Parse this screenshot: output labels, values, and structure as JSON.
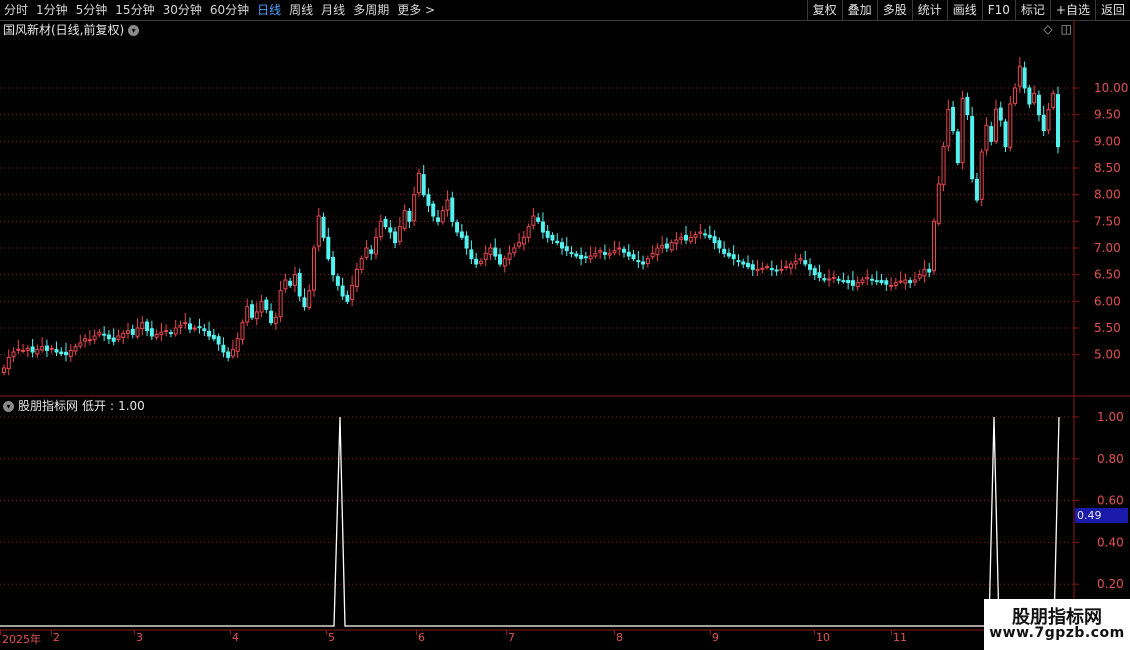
{
  "toolbar": {
    "periods": [
      "分时",
      "1分钟",
      "5分钟",
      "15分钟",
      "30分钟",
      "60分钟",
      "日线",
      "周线",
      "月线",
      "多周期",
      "更多 >"
    ],
    "active_period": "日线",
    "tools": [
      "复权",
      "叠加",
      "多股",
      "统计",
      "画线",
      "F10",
      "标记",
      "+自选",
      "返回"
    ]
  },
  "main_chart": {
    "title": "国风新材(日线,前复权)",
    "y_ticks": [
      "10.00",
      "9.50",
      "9.00",
      "8.50",
      "8.00",
      "7.50",
      "7.00",
      "6.50",
      "6.00",
      "5.50",
      "5.00"
    ],
    "ylim": [
      4.3,
      10.9
    ]
  },
  "indicator": {
    "source": "股朋指标网",
    "name": "低开",
    "value_text": "1.00",
    "y_ticks": [
      "1.00",
      "0.80",
      "0.60",
      "0.40",
      "0.20"
    ],
    "current_value": "0.49"
  },
  "date_axis": {
    "labels": [
      "2025年",
      "2",
      "3",
      "4",
      "5",
      "6",
      "7",
      "8",
      "9",
      "10",
      "11"
    ]
  },
  "watermark": {
    "title": "股朋指标网",
    "url": "www.7gpzb.com"
  },
  "colors": {
    "up": "#e8474f",
    "down": "#54f2ee",
    "grid": "#8a1b1b",
    "axis_text": "#e05252",
    "active": "#4aa3ff"
  },
  "chart_data": {
    "type": "candlestick",
    "ylim": [
      4.3,
      10.9
    ],
    "closes": [
      4.75,
      4.95,
      5.05,
      5.1,
      5.08,
      5.12,
      5.05,
      5.1,
      5.15,
      5.08,
      5.12,
      5.05,
      5.02,
      5.0,
      5.08,
      5.15,
      5.22,
      5.3,
      5.28,
      5.35,
      5.42,
      5.38,
      5.3,
      5.25,
      5.35,
      5.4,
      5.45,
      5.38,
      5.5,
      5.6,
      5.45,
      5.35,
      5.38,
      5.42,
      5.45,
      5.4,
      5.5,
      5.55,
      5.6,
      5.48,
      5.5,
      5.52,
      5.45,
      5.35,
      5.3,
      5.2,
      5.05,
      4.95,
      5.1,
      5.3,
      5.6,
      5.9,
      5.7,
      5.8,
      6.0,
      5.85,
      5.6,
      5.7,
      6.2,
      6.4,
      6.3,
      6.5,
      6.1,
      5.9,
      6.2,
      7.0,
      7.6,
      7.2,
      6.8,
      6.5,
      6.3,
      6.1,
      6.0,
      6.3,
      6.6,
      6.8,
      7.0,
      6.9,
      7.2,
      7.5,
      7.4,
      7.3,
      7.1,
      7.4,
      7.7,
      7.5,
      8.0,
      8.4,
      8.0,
      7.8,
      7.6,
      7.5,
      7.7,
      7.9,
      7.5,
      7.3,
      7.2,
      7.0,
      6.8,
      6.7,
      6.75,
      6.9,
      7.0,
      6.85,
      6.7,
      6.8,
      6.9,
      7.0,
      7.1,
      7.2,
      7.4,
      7.6,
      7.5,
      7.3,
      7.2,
      7.15,
      7.1,
      7.0,
      6.95,
      6.9,
      6.85,
      6.8,
      6.82,
      6.85,
      6.9,
      6.95,
      6.88,
      6.9,
      6.95,
      7.0,
      6.92,
      6.85,
      6.8,
      6.75,
      6.7,
      6.8,
      6.9,
      7.0,
      7.05,
      7.0,
      7.1,
      7.15,
      7.2,
      7.15,
      7.2,
      7.25,
      7.3,
      7.25,
      7.2,
      7.1,
      7.0,
      6.9,
      6.85,
      6.8,
      6.75,
      6.7,
      6.65,
      6.6,
      6.6,
      6.62,
      6.65,
      6.6,
      6.58,
      6.6,
      6.65,
      6.7,
      6.75,
      6.8,
      6.7,
      6.6,
      6.5,
      6.45,
      6.4,
      6.42,
      6.45,
      6.4,
      6.38,
      6.35,
      6.3,
      6.35,
      6.4,
      6.45,
      6.4,
      6.38,
      6.35,
      6.32,
      6.3,
      6.35,
      6.38,
      6.4,
      6.35,
      6.4,
      6.5,
      6.6,
      6.55,
      7.5,
      8.2,
      8.9,
      9.6,
      9.2,
      8.6,
      9.8,
      9.5,
      8.3,
      7.9,
      8.8,
      9.3,
      9.0,
      9.6,
      9.4,
      8.9,
      9.7,
      10.0,
      10.4,
      10.0,
      9.7,
      9.9,
      9.5,
      9.2,
      9.6,
      9.9,
      8.9
    ]
  }
}
